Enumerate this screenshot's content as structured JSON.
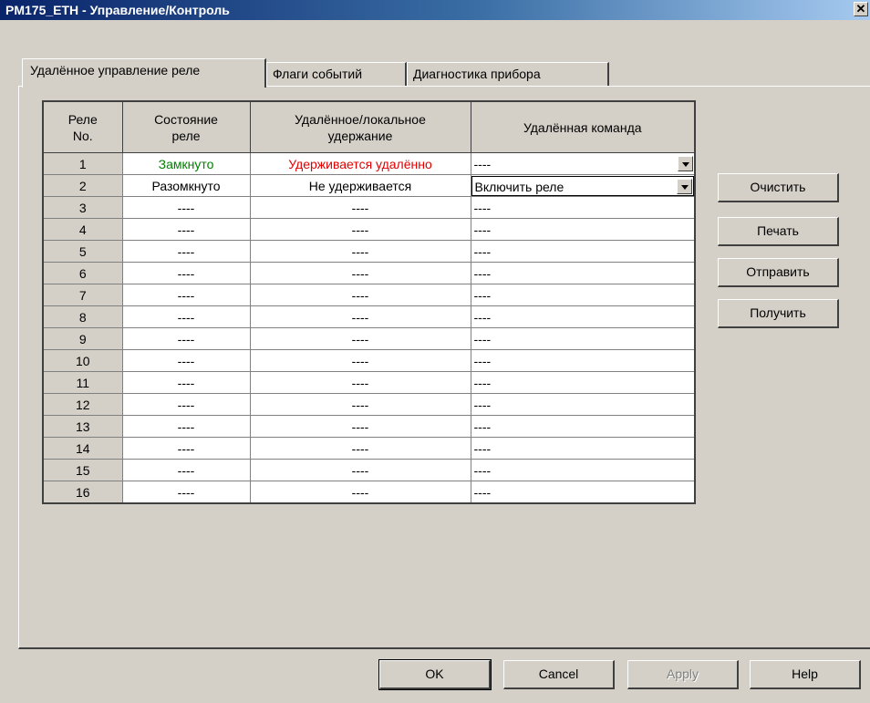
{
  "window": {
    "title": "PM175_ETH - Управление/Контроль",
    "close_label": "✕"
  },
  "tabs": [
    {
      "label": "Удалённое управление реле",
      "active": true
    },
    {
      "label": "Флаги событий",
      "active": false
    },
    {
      "label": "Диагностика прибора",
      "active": false
    }
  ],
  "table": {
    "headers": {
      "no": [
        "Реле",
        "No."
      ],
      "state": [
        "Состояние",
        "реле"
      ],
      "hold": [
        "Удалённое/локальное",
        "удержание"
      ],
      "command": "Удалённая команда"
    },
    "rows": [
      {
        "no": "1",
        "state": "Замкнуто",
        "hold": "Удерживается удалённо",
        "command": "----"
      },
      {
        "no": "2",
        "state": "Разомкнуто",
        "hold": "Не удерживается",
        "command": "Включить реле"
      },
      {
        "no": "3",
        "state": "----",
        "hold": "----",
        "command": "----"
      },
      {
        "no": "4",
        "state": "----",
        "hold": "----",
        "command": "----"
      },
      {
        "no": "5",
        "state": "----",
        "hold": "----",
        "command": "----"
      },
      {
        "no": "6",
        "state": "----",
        "hold": "----",
        "command": "----"
      },
      {
        "no": "7",
        "state": "----",
        "hold": "----",
        "command": "----"
      },
      {
        "no": "8",
        "state": "----",
        "hold": "----",
        "command": "----"
      },
      {
        "no": "9",
        "state": "----",
        "hold": "----",
        "command": "----"
      },
      {
        "no": "10",
        "state": "----",
        "hold": "----",
        "command": "----"
      },
      {
        "no": "11",
        "state": "----",
        "hold": "----",
        "command": "----"
      },
      {
        "no": "12",
        "state": "----",
        "hold": "----",
        "command": "----"
      },
      {
        "no": "13",
        "state": "----",
        "hold": "----",
        "command": "----"
      },
      {
        "no": "14",
        "state": "----",
        "hold": "----",
        "command": "----"
      },
      {
        "no": "15",
        "state": "----",
        "hold": "----",
        "command": "----"
      },
      {
        "no": "16",
        "state": "----",
        "hold": "----",
        "command": "----"
      }
    ]
  },
  "side_buttons": {
    "clear": "Очистить",
    "print": "Печать",
    "send": "Отправить",
    "receive": "Получить"
  },
  "bottom_buttons": {
    "ok": "OK",
    "cancel": "Cancel",
    "apply": "Apply",
    "help": "Help"
  },
  "colors": {
    "closed": "#008000",
    "held_remote": "#e00000",
    "title_bar": "#0a246a",
    "face": "#d4d0c8"
  }
}
